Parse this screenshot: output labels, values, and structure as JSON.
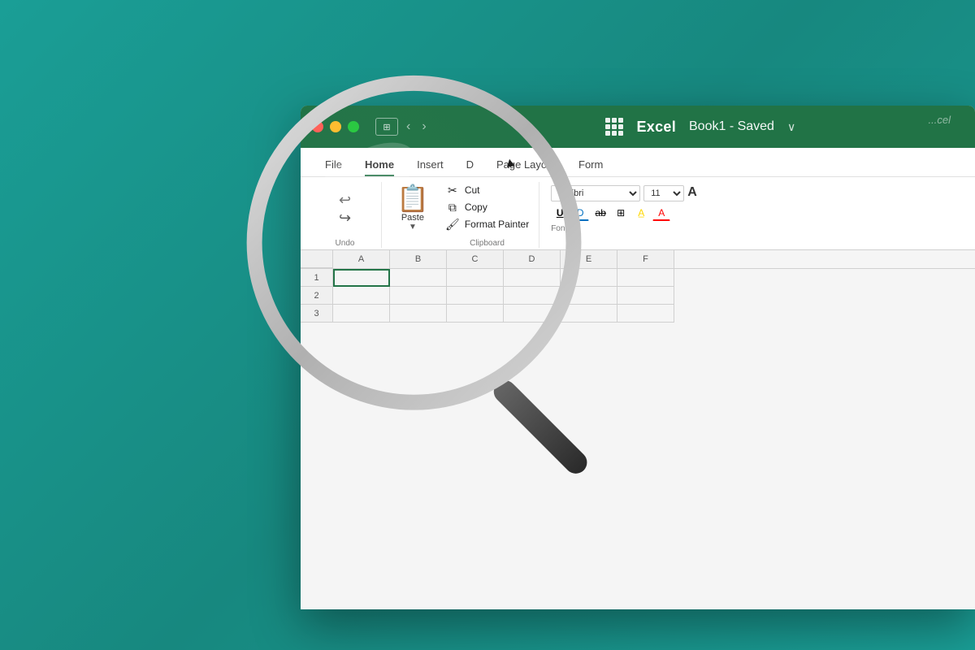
{
  "background": {
    "color": "#1a9e96"
  },
  "window": {
    "title": "Excel",
    "document_title": "Book1 - Saved",
    "traffic_lights": {
      "red": "#ff5f57",
      "yellow": "#febc2e",
      "green": "#28c840"
    }
  },
  "ribbon": {
    "tabs": [
      {
        "label": "File",
        "active": false
      },
      {
        "label": "Home",
        "active": true
      },
      {
        "label": "Insert",
        "active": false
      },
      {
        "label": "D",
        "active": false
      },
      {
        "label": "Page Layout",
        "active": false
      },
      {
        "label": "Form",
        "active": false
      }
    ],
    "groups": {
      "undo": {
        "label": "Undo"
      },
      "clipboard": {
        "label": "Clipboard",
        "paste": "Paste",
        "cut": "Cut",
        "copy": "Copy",
        "format_painter": "Format Painter"
      },
      "font": {
        "label": "Font",
        "font_name": "Calibri",
        "font_size": "11",
        "size_indicator": "A"
      }
    }
  },
  "spreadsheet": {
    "columns": [
      "",
      "A",
      "B",
      "C",
      "D",
      "E",
      "F"
    ],
    "rows": [
      "1",
      "2",
      "3"
    ]
  },
  "detected": {
    "copy_text": "Copy"
  }
}
